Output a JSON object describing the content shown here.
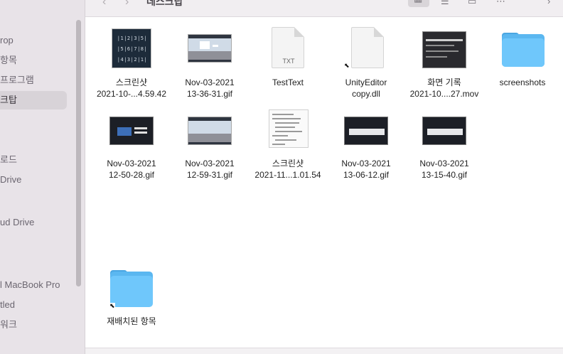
{
  "toolbar": {
    "back_glyph": "‹",
    "forward_glyph": "›",
    "title": "데스크탑",
    "view_icons_glyph": "▦",
    "view_list_glyph": "☰",
    "view_gallery_glyph": "▭",
    "group_glyph": "⋯"
  },
  "sidebar": {
    "items": [
      {
        "label": "rop"
      },
      {
        "label": "항목"
      },
      {
        "label": "프로그램"
      },
      {
        "label": "크탑"
      },
      {
        "label": "로드"
      },
      {
        "label": "Drive"
      },
      {
        "label": "ud Drive"
      },
      {
        "label": "l MacBook Pro"
      },
      {
        "label": "tled"
      },
      {
        "label": "워크"
      }
    ]
  },
  "files": [
    {
      "name_line1": "스크린샷",
      "name_line2": "2021-10-...4.59.42",
      "kind": "image"
    },
    {
      "name_line1": "Nov-03-2021",
      "name_line2": "13-36-31.gif",
      "kind": "gif"
    },
    {
      "name_line1": "TestText",
      "name_line2": "",
      "kind": "text",
      "ext": "TXT"
    },
    {
      "name_line1": "UnityEditor",
      "name_line2": "copy.dll",
      "kind": "alias-doc"
    },
    {
      "name_line1": "화면 기록",
      "name_line2": "2021-10....27.mov",
      "kind": "movie"
    },
    {
      "name_line1": "screenshots",
      "name_line2": "",
      "kind": "folder"
    },
    {
      "name_line1": "Nov-03-2021",
      "name_line2": "12-50-28.gif",
      "kind": "gif"
    },
    {
      "name_line1": "Nov-03-2021",
      "name_line2": "12-59-31.gif",
      "kind": "gif"
    },
    {
      "name_line1": "스크린샷",
      "name_line2": "2021-11...1.01.54",
      "kind": "image"
    },
    {
      "name_line1": "Nov-03-2021",
      "name_line2": "13-06-12.gif",
      "kind": "gif"
    },
    {
      "name_line1": "Nov-03-2021",
      "name_line2": "13-15-40.gif",
      "kind": "gif"
    },
    {
      "name_line1": "재배치된 항목",
      "name_line2": "",
      "kind": "alias-folder"
    }
  ],
  "screenshot1_rows": [
    "|1|2|3|5|",
    "|5|6|7|8|",
    "|4|3|2|1|"
  ],
  "colors": {
    "sidebar_bg": "#e8e3e8",
    "folder": "#6fc7fb",
    "selection": "#d8d3d8"
  }
}
